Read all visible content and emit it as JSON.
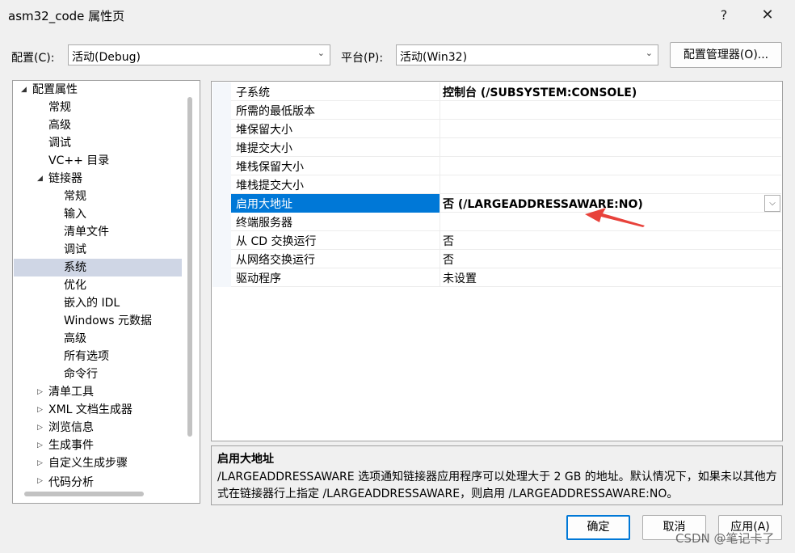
{
  "window": {
    "title": "asm32_code 属性页",
    "help": "?",
    "close": "✕"
  },
  "config": {
    "config_label": "配置(C):",
    "config_value": "活动(Debug)",
    "platform_label": "平台(P):",
    "platform_value": "活动(Win32)",
    "manager_button": "配置管理器(O)..."
  },
  "tree": {
    "items": [
      {
        "label": "配置属性",
        "expander": "◢"
      },
      {
        "label": "常规"
      },
      {
        "label": "高级"
      },
      {
        "label": "调试"
      },
      {
        "label": "VC++ 目录"
      },
      {
        "label": "链接器",
        "expander": "◢"
      },
      {
        "label": "常规"
      },
      {
        "label": "输入"
      },
      {
        "label": "清单文件"
      },
      {
        "label": "调试"
      },
      {
        "label": "系统"
      },
      {
        "label": "优化"
      },
      {
        "label": "嵌入的 IDL"
      },
      {
        "label": "Windows 元数据"
      },
      {
        "label": "高级"
      },
      {
        "label": "所有选项"
      },
      {
        "label": "命令行"
      },
      {
        "label": "清单工具",
        "expander": "▷"
      },
      {
        "label": "XML 文档生成器",
        "expander": "▷"
      },
      {
        "label": "浏览信息",
        "expander": "▷"
      },
      {
        "label": "生成事件",
        "expander": "▷"
      },
      {
        "label": "自定义生成步骤",
        "expander": "▷"
      },
      {
        "label": "代码分析",
        "expander": "▷"
      }
    ]
  },
  "grid": {
    "rows": [
      {
        "name": "子系统",
        "value": "控制台 (/SUBSYSTEM:CONSOLE)"
      },
      {
        "name": "所需的最低版本",
        "value": ""
      },
      {
        "name": "堆保留大小",
        "value": ""
      },
      {
        "name": "堆提交大小",
        "value": ""
      },
      {
        "name": "堆栈保留大小",
        "value": ""
      },
      {
        "name": "堆栈提交大小",
        "value": ""
      },
      {
        "name": "启用大地址",
        "value": "否 (/LARGEADDRESSAWARE:NO)"
      },
      {
        "name": "终端服务器",
        "value": ""
      },
      {
        "name": "从 CD 交换运行",
        "value": "否"
      },
      {
        "name": "从网络交换运行",
        "value": "否"
      },
      {
        "name": "驱动程序",
        "value": "未设置"
      }
    ],
    "dropdown_icon": "chevron-down"
  },
  "description": {
    "title": "启用大地址",
    "text": "/LARGEADDRESSAWARE 选项通知链接器应用程序可以处理大于 2 GB 的地址。默认情况下，如果未以其他方式在链接器行上指定 /LARGEADDRESSAWARE，则启用 /LARGEADDRESSAWARE:NO。"
  },
  "buttons": {
    "ok": "确定",
    "cancel": "取消",
    "apply": "应用(A)"
  },
  "watermark": "CSDN @笔记卡了",
  "colors": {
    "selection": "#0078d7",
    "tree_selection": "#cfd6e5",
    "arrow": "#e8423b"
  }
}
